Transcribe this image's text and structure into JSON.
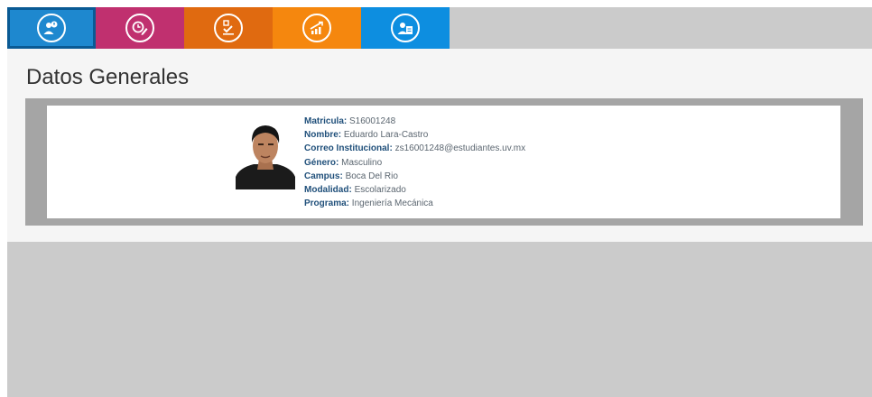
{
  "nav": {
    "tabs": [
      {
        "icon": "users-info-icon",
        "color": "#1e88cf",
        "active": true
      },
      {
        "icon": "clock-edit-icon",
        "color": "#c0306f",
        "active": false
      },
      {
        "icon": "checklist-icon",
        "color": "#e06a10",
        "active": false
      },
      {
        "icon": "growth-chart-icon",
        "color": "#f5870e",
        "active": false
      },
      {
        "icon": "user-document-icon",
        "color": "#0d8ee0",
        "active": false
      }
    ]
  },
  "page": {
    "title": "Datos Generales"
  },
  "student": {
    "photo_icon": "student-photo",
    "fields": {
      "matricula": {
        "label": "Matricula:",
        "value": "S16001248"
      },
      "nombre": {
        "label": "Nombre:",
        "value": "Eduardo Lara-Castro"
      },
      "correo": {
        "label": "Correo Institucional:",
        "value": "zs16001248@estudiantes.uv.mx"
      },
      "genero": {
        "label": "Género:",
        "value": "Masculino"
      },
      "campus": {
        "label": "Campus:",
        "value": "Boca Del Rio"
      },
      "modalidad": {
        "label": "Modalidad:",
        "value": "Escolarizado"
      },
      "programa": {
        "label": "Programa:",
        "value": "Ingeniería Mecánica"
      }
    }
  }
}
